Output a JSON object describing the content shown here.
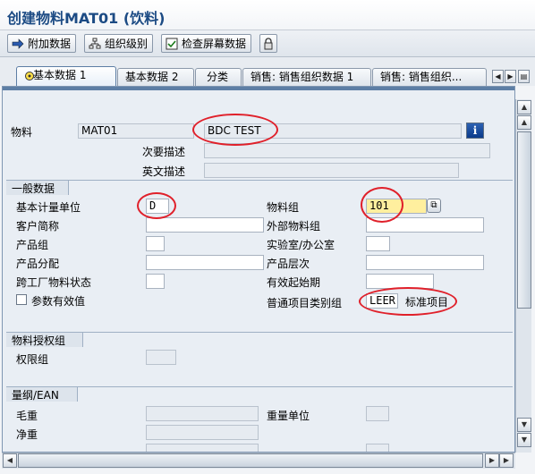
{
  "window": {
    "title": "创建物料MAT01 (饮料)"
  },
  "toolbar": {
    "additional_data": "附加数据",
    "org_levels": "组织级别",
    "check_screen_data": "检查屏幕数据"
  },
  "tabs": [
    {
      "label": "基本数据 1",
      "active": true
    },
    {
      "label": "基本数据 2"
    },
    {
      "label": "分类"
    },
    {
      "label": "销售: 销售组织数据 1"
    },
    {
      "label": "销售: 销售组织..."
    }
  ],
  "header": {
    "material_label": "物料",
    "material_value": "MAT01",
    "description_value": "BDC TEST",
    "secondary_desc_label": "次要描述",
    "english_desc_label": "英文描述"
  },
  "general": {
    "title": "一般数据",
    "base_uom_label": "基本计量单位",
    "base_uom_value": "D",
    "material_group_label": "物料组",
    "material_group_value": "101",
    "customer_abbr_label": "客户简称",
    "external_material_group_label": "外部物料组",
    "product_group_label": "产品组",
    "lab_office_label": "实验室/办公室",
    "product_allocation_label": "产品分配",
    "product_hierarchy_label": "产品层次",
    "cross_plant_status_label": "跨工厂物料状态",
    "valid_from_label": "有效起始期",
    "param_effectivity_label": "参数有效值",
    "gen_item_cat_group_label": "普通项目类别组",
    "gen_item_cat_group_value": "LEER",
    "gen_item_cat_group_text": "标准项目"
  },
  "authorization": {
    "title": "物料授权组",
    "auth_group_label": "权限组"
  },
  "dimensions": {
    "title": "量纲/EAN",
    "gross_weight_label": "毛重",
    "weight_unit_label": "重量单位",
    "net_weight_label": "净重"
  },
  "colors": {
    "annotation_circle": "#e0202a",
    "title_text": "#1c4b84"
  }
}
